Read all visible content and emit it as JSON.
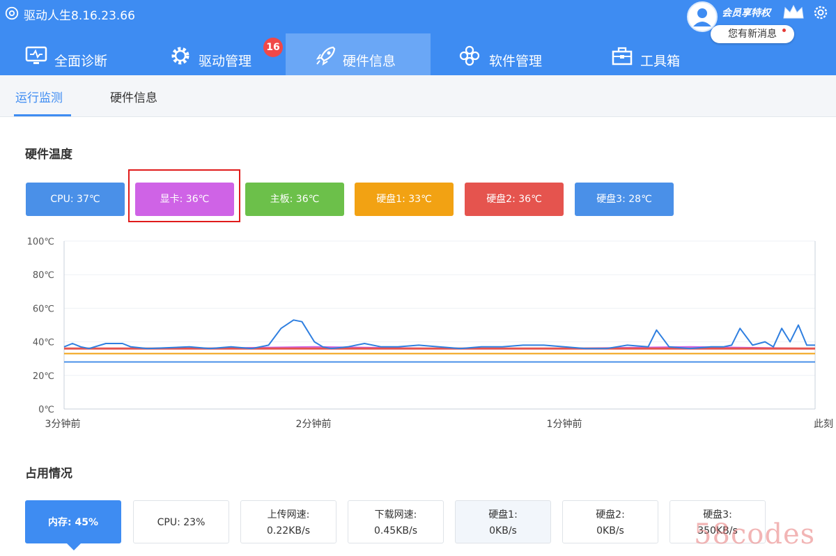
{
  "app": {
    "title": "驱动人生8.16.23.66"
  },
  "header": {
    "vip_label": "会员享特权",
    "message_bubble": "您有新消息"
  },
  "nav": {
    "tabs": [
      {
        "label": "全面诊断",
        "icon": "monitor-icon"
      },
      {
        "label": "驱动管理",
        "icon": "gear-icon",
        "badge": "16"
      },
      {
        "label": "硬件信息",
        "icon": "rocket-icon",
        "active": true
      },
      {
        "label": "软件管理",
        "icon": "flower-icon"
      },
      {
        "label": "工具箱",
        "icon": "toolbox-icon"
      }
    ]
  },
  "subnav": {
    "tabs": [
      {
        "label": "运行监测",
        "active": true
      },
      {
        "label": "硬件信息"
      }
    ]
  },
  "temperature": {
    "section_title": "硬件温度",
    "chips": [
      {
        "label": "CPU: 37℃",
        "color": "#4a90e8"
      },
      {
        "label": "显卡: 36℃",
        "color": "#cf63e6"
      },
      {
        "label": "主板: 36℃",
        "color": "#6cc04a"
      },
      {
        "label": "硬盘1: 33℃",
        "color": "#f2a213"
      },
      {
        "label": "硬盘2: 36℃",
        "color": "#e5544e"
      },
      {
        "label": "硬盘3: 28℃",
        "color": "#4a90e8"
      }
    ]
  },
  "chart_data": {
    "type": "line",
    "ylim": [
      0,
      100
    ],
    "y_ticks": [
      "100℃",
      "80℃",
      "60℃",
      "40℃",
      "20℃",
      "0℃"
    ],
    "x_ticks": [
      "3分钟前",
      "2分钟前",
      "1分钟前",
      "此刻"
    ],
    "x_range_seconds": [
      -180,
      0
    ],
    "series": [
      {
        "color": "#2f7fe0",
        "x": [
          -180,
          -178,
          -176,
          -174,
          -170,
          -166,
          -164,
          -160,
          -150,
          -145,
          -140,
          -135,
          -131,
          -128,
          -125,
          -123,
          -120,
          -118,
          -116,
          -112,
          -108,
          -104,
          -100,
          -95,
          -85,
          -80,
          -75,
          -70,
          -65,
          -55,
          -50,
          -45,
          -40,
          -38,
          -35,
          -30,
          -25,
          -22,
          -20,
          -18,
          -15,
          -12,
          -10,
          -8,
          -6,
          -4,
          -2,
          0
        ],
        "y": [
          37,
          39,
          37,
          36,
          39,
          39,
          37,
          36,
          37,
          36,
          37,
          36,
          38,
          48,
          53,
          52,
          40,
          37,
          36,
          37,
          39,
          37,
          37,
          38,
          36,
          37,
          37,
          38,
          38,
          36,
          36,
          38,
          37,
          47,
          37,
          36,
          37,
          37,
          38,
          48,
          38,
          40,
          37,
          48,
          40,
          50,
          38,
          38
        ]
      },
      {
        "color": "#cf63e6",
        "x": [
          -180,
          -150,
          -120,
          -90,
          -60,
          -30,
          0
        ],
        "y": [
          36,
          36,
          37,
          36,
          36,
          37,
          36
        ]
      },
      {
        "color": "#6cc04a",
        "x": [
          -180,
          -120,
          -60,
          0
        ],
        "y": [
          36,
          36,
          36,
          36
        ]
      },
      {
        "color": "#f2a213",
        "x": [
          -180,
          -120,
          -60,
          0
        ],
        "y": [
          33,
          33,
          33,
          33
        ]
      },
      {
        "color": "#e5544e",
        "x": [
          -180,
          -120,
          -60,
          0
        ],
        "y": [
          36,
          36,
          36,
          36
        ]
      },
      {
        "color": "#4a90e8",
        "x": [
          -180,
          -120,
          -60,
          0
        ],
        "y": [
          28,
          28,
          28,
          28
        ]
      }
    ]
  },
  "usage": {
    "section_title": "占用情况",
    "cards": [
      {
        "label": "内存: 45%",
        "active": true
      },
      {
        "label": "CPU: 23%"
      },
      {
        "title": "上传网速:",
        "value": "0.22KB/s"
      },
      {
        "title": "下载网速:",
        "value": "0.45KB/s"
      },
      {
        "title": "硬盘1:",
        "value": "0KB/s"
      },
      {
        "title": "硬盘2:",
        "value": "0KB/s"
      },
      {
        "title": "硬盘3:",
        "value": "350KB/s"
      }
    ]
  },
  "watermark": "58codes"
}
